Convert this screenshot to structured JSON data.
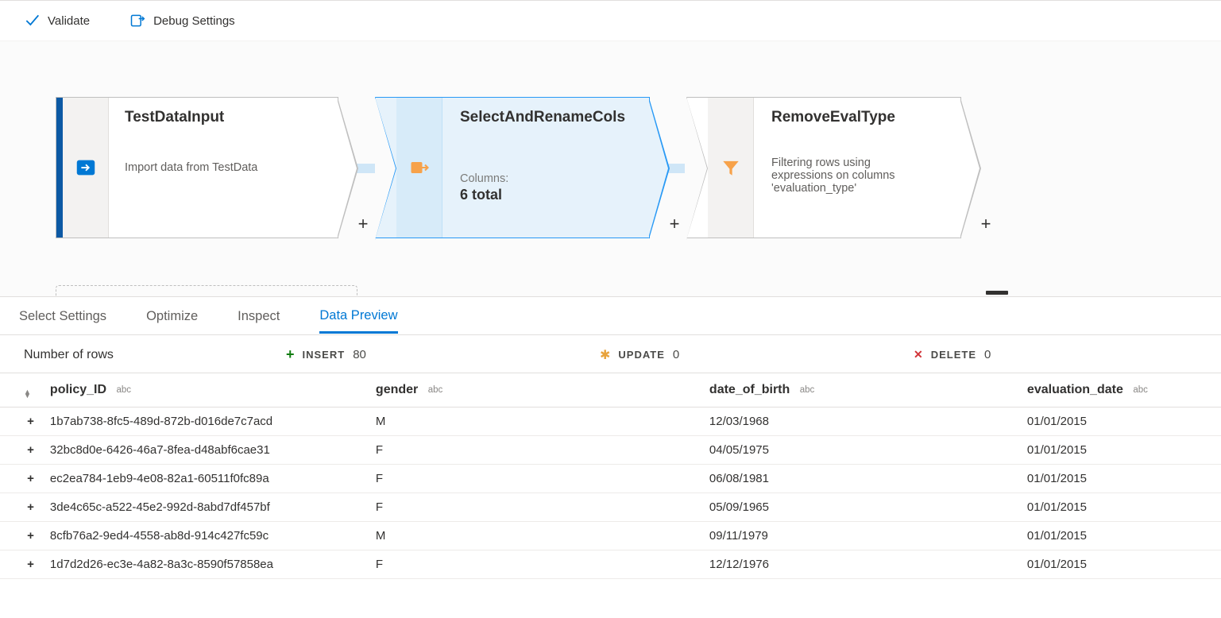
{
  "toolbar": {
    "validate": "Validate",
    "debug_settings": "Debug Settings"
  },
  "flow": {
    "nodes": [
      {
        "title": "TestDataInput",
        "description": "Import data from TestData"
      },
      {
        "title": "SelectAndRenameCols",
        "sub_label": "Columns:",
        "sub_value": "6 total"
      },
      {
        "title": "RemoveEvalType",
        "description": "Filtering rows using expressions on columns 'evaluation_type'"
      }
    ],
    "add": "+",
    "selected_index": 1
  },
  "panel_tabs": {
    "select_settings": "Select Settings",
    "optimize": "Optimize",
    "inspect": "Inspect",
    "data_preview": "Data Preview",
    "active": "data_preview"
  },
  "stats": {
    "number_of_rows_label": "Number of rows",
    "insert_label": "INSERT",
    "insert_value": "80",
    "update_label": "UPDATE",
    "update_value": "0",
    "delete_label": "DELETE",
    "delete_value": "0"
  },
  "columns": {
    "policy_ID": {
      "header": "policy_ID",
      "type": "abc"
    },
    "gender": {
      "header": "gender",
      "type": "abc"
    },
    "date_of_birth": {
      "header": "date_of_birth",
      "type": "abc"
    },
    "evaluation_date": {
      "header": "evaluation_date",
      "type": "abc"
    }
  },
  "rows": [
    {
      "policy_ID": "1b7ab738-8fc5-489d-872b-d016de7c7acd",
      "gender": "M",
      "date_of_birth": "12/03/1968",
      "evaluation_date": "01/01/2015"
    },
    {
      "policy_ID": "32bc8d0e-6426-46a7-8fea-d48abf6cae31",
      "gender": "F",
      "date_of_birth": "04/05/1975",
      "evaluation_date": "01/01/2015"
    },
    {
      "policy_ID": "ec2ea784-1eb9-4e08-82a1-60511f0fc89a",
      "gender": "F",
      "date_of_birth": "06/08/1981",
      "evaluation_date": "01/01/2015"
    },
    {
      "policy_ID": "3de4c65c-a522-45e2-992d-8abd7df457bf",
      "gender": "F",
      "date_of_birth": "05/09/1965",
      "evaluation_date": "01/01/2015"
    },
    {
      "policy_ID": "8cfb76a2-9ed4-4558-ab8d-914c427fc59c",
      "gender": "M",
      "date_of_birth": "09/11/1979",
      "evaluation_date": "01/01/2015"
    },
    {
      "policy_ID": "1d7d2d26-ec3e-4a82-8a3c-8590f57858ea",
      "gender": "F",
      "date_of_birth": "12/12/1976",
      "evaluation_date": "01/01/2015"
    }
  ]
}
